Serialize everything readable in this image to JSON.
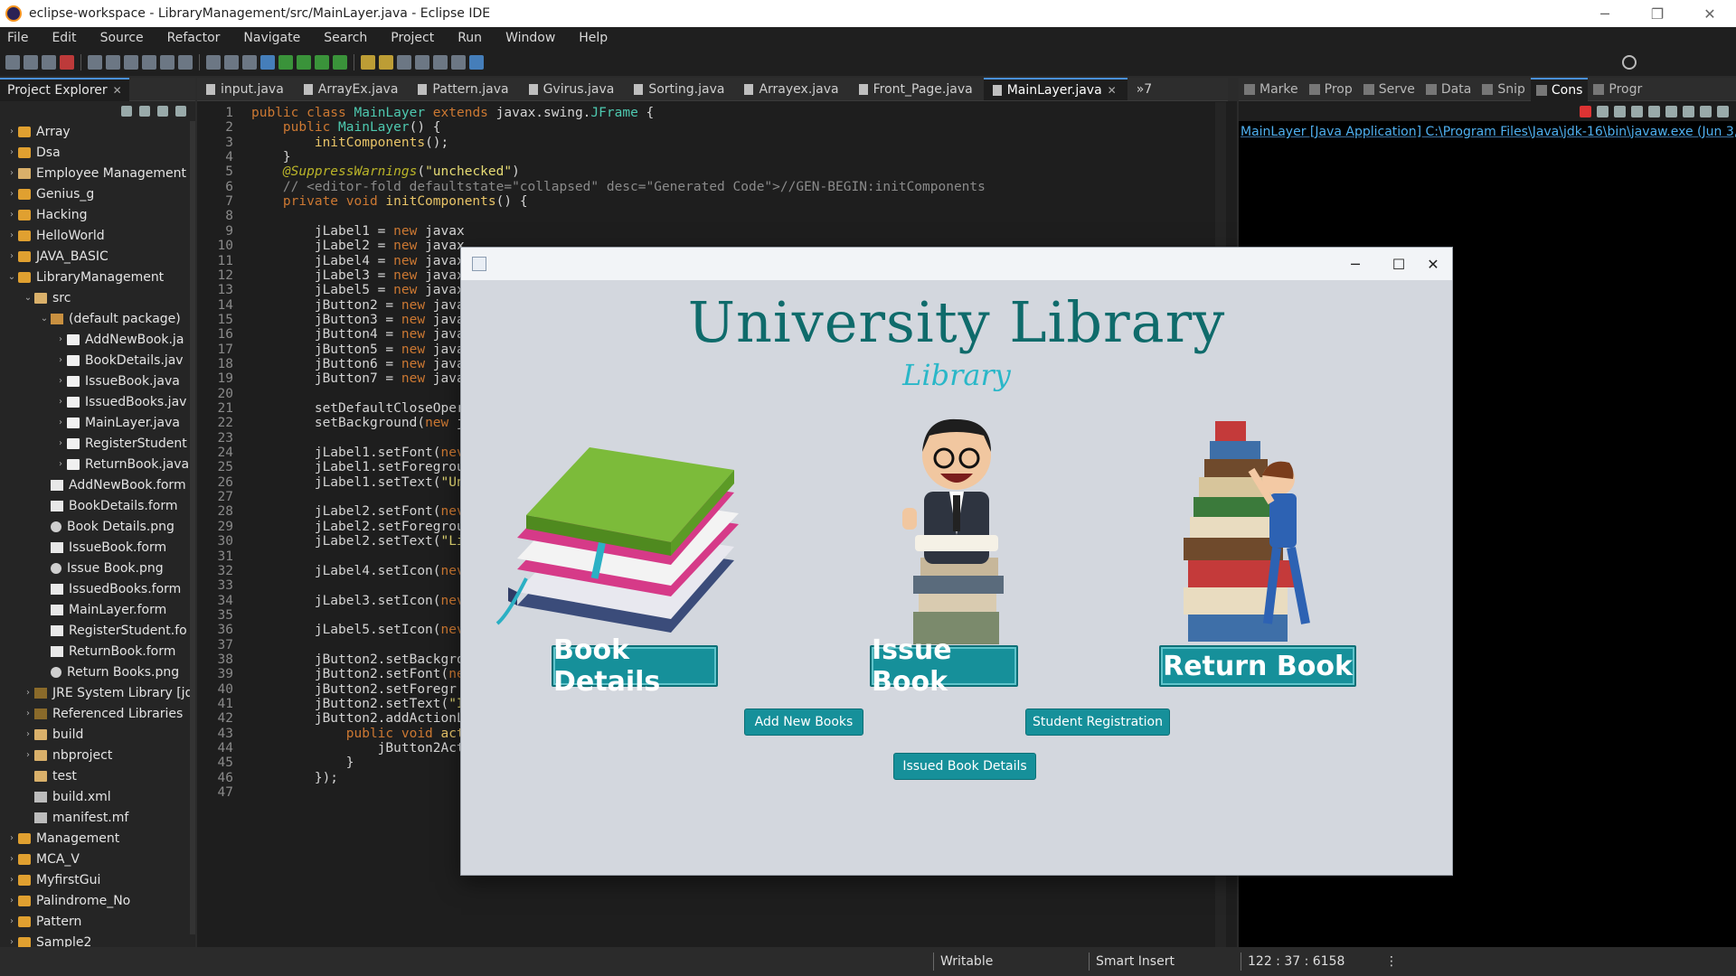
{
  "window": {
    "title": "eclipse-workspace - LibraryManagement/src/MainLayer.java - Eclipse IDE"
  },
  "menu": [
    "File",
    "Edit",
    "Source",
    "Refactor",
    "Navigate",
    "Search",
    "Project",
    "Run",
    "Window",
    "Help"
  ],
  "explorer": {
    "tab_label": "Project Explorer",
    "items": [
      {
        "label": "Array",
        "indent": 0,
        "icon": "project-icon",
        "arrow": "›"
      },
      {
        "label": "Dsa",
        "indent": 0,
        "icon": "project-icon",
        "arrow": "›"
      },
      {
        "label": "Employee Management",
        "indent": 0,
        "icon": "folder-icon",
        "arrow": "›"
      },
      {
        "label": "Genius_g",
        "indent": 0,
        "icon": "project-icon",
        "arrow": "›"
      },
      {
        "label": "Hacking",
        "indent": 0,
        "icon": "project-icon",
        "arrow": "›"
      },
      {
        "label": "HelloWorld",
        "indent": 0,
        "icon": "project-icon",
        "arrow": "›"
      },
      {
        "label": "JAVA_BASIC",
        "indent": 0,
        "icon": "project-icon",
        "arrow": "›"
      },
      {
        "label": "LibraryManagement",
        "indent": 0,
        "icon": "project-icon",
        "arrow": "⌄"
      },
      {
        "label": "src",
        "indent": 1,
        "icon": "source-folder-icon",
        "arrow": "⌄"
      },
      {
        "label": "(default package)",
        "indent": 2,
        "icon": "package-icon",
        "arrow": "⌄"
      },
      {
        "label": "AddNewBook.ja",
        "indent": 3,
        "icon": "java-file-icon",
        "arrow": "›"
      },
      {
        "label": "BookDetails.jav",
        "indent": 3,
        "icon": "java-file-icon",
        "arrow": "›"
      },
      {
        "label": "IssueBook.java",
        "indent": 3,
        "icon": "java-file-icon",
        "arrow": "›"
      },
      {
        "label": "IssuedBooks.jav",
        "indent": 3,
        "icon": "java-file-icon",
        "arrow": "›"
      },
      {
        "label": "MainLayer.java",
        "indent": 3,
        "icon": "java-file-icon",
        "arrow": "›"
      },
      {
        "label": "RegisterStudent",
        "indent": 3,
        "icon": "java-file-icon",
        "arrow": "›"
      },
      {
        "label": "ReturnBook.java",
        "indent": 3,
        "icon": "java-file-icon",
        "arrow": "›"
      },
      {
        "label": "AddNewBook.form",
        "indent": 2,
        "icon": "form-file-icon",
        "arrow": ""
      },
      {
        "label": "BookDetails.form",
        "indent": 2,
        "icon": "form-file-icon",
        "arrow": ""
      },
      {
        "label": "Book Details.png",
        "indent": 2,
        "icon": "image-file-icon",
        "arrow": ""
      },
      {
        "label": "IssueBook.form",
        "indent": 2,
        "icon": "form-file-icon",
        "arrow": ""
      },
      {
        "label": "Issue Book.png",
        "indent": 2,
        "icon": "image-file-icon",
        "arrow": ""
      },
      {
        "label": "IssuedBooks.form",
        "indent": 2,
        "icon": "form-file-icon",
        "arrow": ""
      },
      {
        "label": "MainLayer.form",
        "indent": 2,
        "icon": "form-file-icon",
        "arrow": ""
      },
      {
        "label": "RegisterStudent.fo",
        "indent": 2,
        "icon": "form-file-icon",
        "arrow": ""
      },
      {
        "label": "ReturnBook.form",
        "indent": 2,
        "icon": "form-file-icon",
        "arrow": ""
      },
      {
        "label": "Return Books.png",
        "indent": 2,
        "icon": "image-file-icon",
        "arrow": ""
      },
      {
        "label": "JRE System Library [jd",
        "indent": 1,
        "icon": "library-icon",
        "arrow": "›"
      },
      {
        "label": "Referenced Libraries",
        "indent": 1,
        "icon": "library-icon",
        "arrow": "›"
      },
      {
        "label": "build",
        "indent": 1,
        "icon": "folder-icon",
        "arrow": "›"
      },
      {
        "label": "nbproject",
        "indent": 1,
        "icon": "folder-icon",
        "arrow": "›"
      },
      {
        "label": "test",
        "indent": 1,
        "icon": "folder-icon",
        "arrow": ""
      },
      {
        "label": "build.xml",
        "indent": 1,
        "icon": "xml-file-icon",
        "arrow": ""
      },
      {
        "label": "manifest.mf",
        "indent": 1,
        "icon": "text-file-icon",
        "arrow": ""
      },
      {
        "label": "Management",
        "indent": 0,
        "icon": "project-icon",
        "arrow": "›"
      },
      {
        "label": "MCA_V",
        "indent": 0,
        "icon": "project-icon",
        "arrow": "›"
      },
      {
        "label": "MyfirstGui",
        "indent": 0,
        "icon": "project-icon",
        "arrow": "›"
      },
      {
        "label": "Palindrome_No",
        "indent": 0,
        "icon": "project-icon",
        "arrow": "›"
      },
      {
        "label": "Pattern",
        "indent": 0,
        "icon": "project-icon",
        "arrow": "›"
      },
      {
        "label": "Sample2",
        "indent": 0,
        "icon": "project-icon",
        "arrow": "›"
      }
    ]
  },
  "editor": {
    "tabs": [
      {
        "label": "input.java",
        "active": false
      },
      {
        "label": "ArrayEx.java",
        "active": false
      },
      {
        "label": "Pattern.java",
        "active": false
      },
      {
        "label": "Gvirus.java",
        "active": false
      },
      {
        "label": "Sorting.java",
        "active": false
      },
      {
        "label": "Arrayex.java",
        "active": false
      },
      {
        "label": "Front_Page.java",
        "active": false
      },
      {
        "label": "MainLayer.java",
        "active": true
      }
    ],
    "overflow_label": "»7",
    "lines": [
      {
        "n": "1",
        "segs": [
          [
            "kw",
            "public class "
          ],
          [
            "ty",
            "MainLayer"
          ],
          [
            "kw",
            " extends "
          ],
          [
            "",
            "javax.swing."
          ],
          [
            "ty",
            "JFrame"
          ],
          [
            "",
            " {"
          ]
        ]
      },
      {
        "n": "2",
        "segs": [
          [
            "kw",
            "    public "
          ],
          [
            "ty",
            "MainLayer"
          ],
          [
            "",
            "() {"
          ]
        ]
      },
      {
        "n": "3",
        "segs": [
          [
            "",
            "        "
          ],
          [
            "fn",
            "initComponents"
          ],
          [
            "",
            "();"
          ]
        ]
      },
      {
        "n": "4",
        "segs": [
          [
            "",
            "    }"
          ]
        ]
      },
      {
        "n": "5",
        "segs": [
          [
            "ann",
            "    @SuppressWarnings"
          ],
          [
            "",
            "("
          ],
          [
            "str",
            "\"unchecked\""
          ],
          [
            "",
            ")"
          ]
        ]
      },
      {
        "n": "6",
        "segs": [
          [
            "cm",
            "    // <editor-fold defaultstate=\"collapsed\" desc=\"Generated Code\">//GEN-BEGIN:initComponents"
          ]
        ]
      },
      {
        "n": "7",
        "segs": [
          [
            "kw",
            "    private void "
          ],
          [
            "fn",
            "initComponents"
          ],
          [
            "",
            "() {"
          ]
        ]
      },
      {
        "n": "8",
        "segs": [
          [
            "",
            ""
          ]
        ]
      },
      {
        "n": "9",
        "segs": [
          [
            "",
            "        jLabel1 = "
          ],
          [
            "kw",
            "new "
          ],
          [
            "",
            "javax"
          ]
        ]
      },
      {
        "n": "10",
        "segs": [
          [
            "",
            "        jLabel2 = "
          ],
          [
            "kw",
            "new "
          ],
          [
            "",
            "javax"
          ]
        ]
      },
      {
        "n": "11",
        "segs": [
          [
            "",
            "        jLabel4 = "
          ],
          [
            "kw",
            "new "
          ],
          [
            "",
            "javax"
          ]
        ]
      },
      {
        "n": "12",
        "segs": [
          [
            "",
            "        jLabel3 = "
          ],
          [
            "kw",
            "new "
          ],
          [
            "",
            "javax"
          ]
        ]
      },
      {
        "n": "13",
        "segs": [
          [
            "",
            "        jLabel5 = "
          ],
          [
            "kw",
            "new "
          ],
          [
            "",
            "javax"
          ]
        ]
      },
      {
        "n": "14",
        "segs": [
          [
            "",
            "        jButton2 = "
          ],
          [
            "kw",
            "new "
          ],
          [
            "",
            "java"
          ]
        ]
      },
      {
        "n": "15",
        "segs": [
          [
            "",
            "        jButton3 = "
          ],
          [
            "kw",
            "new "
          ],
          [
            "",
            "java"
          ]
        ]
      },
      {
        "n": "16",
        "segs": [
          [
            "",
            "        jButton4 = "
          ],
          [
            "kw",
            "new "
          ],
          [
            "",
            "java"
          ]
        ]
      },
      {
        "n": "17",
        "segs": [
          [
            "",
            "        jButton5 = "
          ],
          [
            "kw",
            "new "
          ],
          [
            "",
            "java"
          ]
        ]
      },
      {
        "n": "18",
        "segs": [
          [
            "",
            "        jButton6 = "
          ],
          [
            "kw",
            "new "
          ],
          [
            "",
            "java"
          ]
        ]
      },
      {
        "n": "19",
        "segs": [
          [
            "",
            "        jButton7 = "
          ],
          [
            "kw",
            "new "
          ],
          [
            "",
            "java"
          ]
        ]
      },
      {
        "n": "20",
        "segs": [
          [
            "",
            ""
          ]
        ]
      },
      {
        "n": "21",
        "segs": [
          [
            "",
            "        setDefaultCloseOper"
          ]
        ]
      },
      {
        "n": "22",
        "segs": [
          [
            "",
            "        setBackground("
          ],
          [
            "kw",
            "new "
          ],
          [
            "",
            "j"
          ]
        ]
      },
      {
        "n": "23",
        "segs": [
          [
            "",
            ""
          ]
        ]
      },
      {
        "n": "24",
        "segs": [
          [
            "",
            "        jLabel1.setFont("
          ],
          [
            "kw",
            "nev"
          ]
        ]
      },
      {
        "n": "25",
        "segs": [
          [
            "",
            "        jLabel1.setForegrou"
          ]
        ]
      },
      {
        "n": "26",
        "segs": [
          [
            "",
            "        jLabel1.setText("
          ],
          [
            "str",
            "\"Un"
          ]
        ]
      },
      {
        "n": "27",
        "segs": [
          [
            "",
            ""
          ]
        ]
      },
      {
        "n": "28",
        "segs": [
          [
            "",
            "        jLabel2.setFont("
          ],
          [
            "kw",
            "nev"
          ]
        ]
      },
      {
        "n": "29",
        "segs": [
          [
            "",
            "        jLabel2.setForegrou"
          ]
        ]
      },
      {
        "n": "30",
        "segs": [
          [
            "",
            "        jLabel2.setText("
          ],
          [
            "str",
            "\"Li"
          ]
        ]
      },
      {
        "n": "31",
        "segs": [
          [
            "",
            ""
          ]
        ]
      },
      {
        "n": "32",
        "segs": [
          [
            "",
            "        jLabel4.setIcon("
          ],
          [
            "kw",
            "nev"
          ]
        ]
      },
      {
        "n": "33",
        "segs": [
          [
            "",
            ""
          ]
        ]
      },
      {
        "n": "34",
        "segs": [
          [
            "",
            "        jLabel3.setIcon("
          ],
          [
            "kw",
            "nev"
          ]
        ]
      },
      {
        "n": "35",
        "segs": [
          [
            "",
            ""
          ]
        ]
      },
      {
        "n": "36",
        "segs": [
          [
            "",
            "        jLabel5.setIcon("
          ],
          [
            "kw",
            "nev"
          ]
        ]
      },
      {
        "n": "37",
        "segs": [
          [
            "",
            ""
          ]
        ]
      },
      {
        "n": "38",
        "segs": [
          [
            "",
            "        jButton2.setBackgro"
          ]
        ]
      },
      {
        "n": "39",
        "segs": [
          [
            "",
            "        jButton2.setFont("
          ],
          [
            "kw",
            "ne"
          ]
        ]
      },
      {
        "n": "40",
        "segs": [
          [
            "",
            "        jButton2.setForegr"
          ]
        ]
      },
      {
        "n": "41",
        "segs": [
          [
            "",
            "        jButton2.setText("
          ],
          [
            "str",
            "\"I"
          ]
        ]
      },
      {
        "n": "42",
        "segs": [
          [
            "",
            "        jButton2.addActionL"
          ]
        ]
      },
      {
        "n": "43",
        "segs": [
          [
            "kw",
            "            public void "
          ],
          [
            "fn",
            "act"
          ]
        ]
      },
      {
        "n": "44",
        "segs": [
          [
            "",
            "                jButton2ActionPerformed("
          ],
          [
            "fn",
            "evt"
          ],
          [
            "",
            ");"
          ]
        ]
      },
      {
        "n": "45",
        "segs": [
          [
            "",
            "            }"
          ]
        ]
      },
      {
        "n": "46",
        "segs": [
          [
            "",
            "        });"
          ]
        ]
      },
      {
        "n": "47",
        "segs": [
          [
            "",
            ""
          ]
        ]
      }
    ]
  },
  "right_panel": {
    "tabs": [
      {
        "label": "Marke",
        "active": false
      },
      {
        "label": "Prop",
        "active": false
      },
      {
        "label": "Serve",
        "active": false
      },
      {
        "label": "Data",
        "active": false
      },
      {
        "label": "Snip",
        "active": false
      },
      {
        "label": "Cons",
        "active": true
      },
      {
        "label": "Progr",
        "active": false
      }
    ],
    "console_line": "MainLayer [Java Application] C:\\Program Files\\Java\\jdk-16\\bin\\javaw.exe  (Jun 3, 20"
  },
  "status": {
    "writable": "Writable",
    "insert_mode": "Smart Insert",
    "position": "122 : 37 : 6158"
  },
  "app": {
    "heading": "University Library",
    "subtitle": "Library",
    "buttons": {
      "book_details": "Book Details",
      "issue_book": "Issue Book",
      "return_book": "Return Book",
      "add_new_books": "Add New Books",
      "student_registration": "Student Registration",
      "issued_book_details": "Issued Book Details"
    },
    "colors": {
      "heading": "#0f6b6b",
      "subtitle": "#2ab7c8",
      "button": "#16909a",
      "background": "#d3d7de"
    }
  }
}
